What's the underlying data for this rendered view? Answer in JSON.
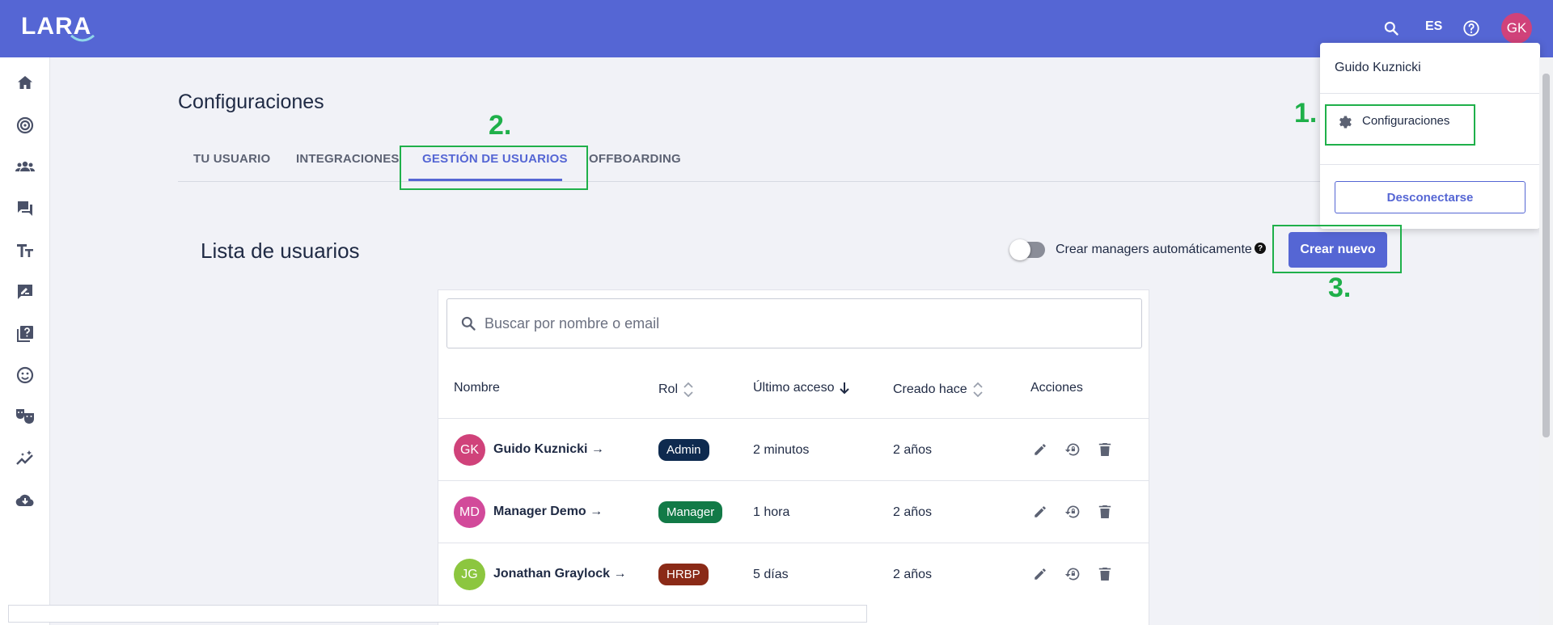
{
  "app": {
    "logo_text": "LARA",
    "lang": "ES",
    "user_initials": "GK"
  },
  "colors": {
    "brand": "#5566d4",
    "annotation_green": "#1fb04a",
    "admin_badge": "#0e2a4f",
    "manager_badge": "#127a47",
    "hrbp_badge": "#8a2a17"
  },
  "sidebar": {
    "items": [
      {
        "icon": "home-icon"
      },
      {
        "icon": "target-icon"
      },
      {
        "icon": "team-icon"
      },
      {
        "icon": "chat-icon"
      },
      {
        "icon": "text-size-icon"
      },
      {
        "icon": "feedback-icon"
      },
      {
        "icon": "quiz-icon"
      },
      {
        "icon": "smiley-icon"
      },
      {
        "icon": "masks-icon"
      },
      {
        "icon": "analytics-icon"
      },
      {
        "icon": "cloud-download-icon"
      }
    ]
  },
  "page": {
    "title": "Configuraciones"
  },
  "tabs": [
    {
      "label": "TU USUARIO"
    },
    {
      "label": "INTEGRACIONES"
    },
    {
      "label": "GESTIÓN DE USUARIOS"
    },
    {
      "label": "OFFBOARDING"
    }
  ],
  "users_section": {
    "title": "Lista de usuarios",
    "toggle_label": "Crear managers automáticamente",
    "help_symbol": "?",
    "create_button": "Crear nuevo",
    "search_placeholder": "Buscar por nombre o email",
    "columns": {
      "name": "Nombre",
      "role": "Rol",
      "last_access": "Último acceso",
      "created": "Creado hace",
      "actions": "Acciones"
    },
    "rows": [
      {
        "initials": "GK",
        "name": "Guido Kuznicki",
        "role": "Admin",
        "last_access": "2 minutos",
        "created": "2 años"
      },
      {
        "initials": "MD",
        "name": "Manager Demo",
        "role": "Manager",
        "last_access": "1 hora",
        "created": "2 años"
      },
      {
        "initials": "JG",
        "name": "Jonathan Graylock",
        "role": "HRBP",
        "last_access": "5 días",
        "created": "2 años"
      }
    ]
  },
  "dropdown": {
    "user_name": "Guido Kuznicki",
    "settings_label": "Configuraciones",
    "logout_label": "Desconectarse"
  },
  "annotations": {
    "step1": "1.",
    "step2": "2.",
    "step3": "3."
  }
}
